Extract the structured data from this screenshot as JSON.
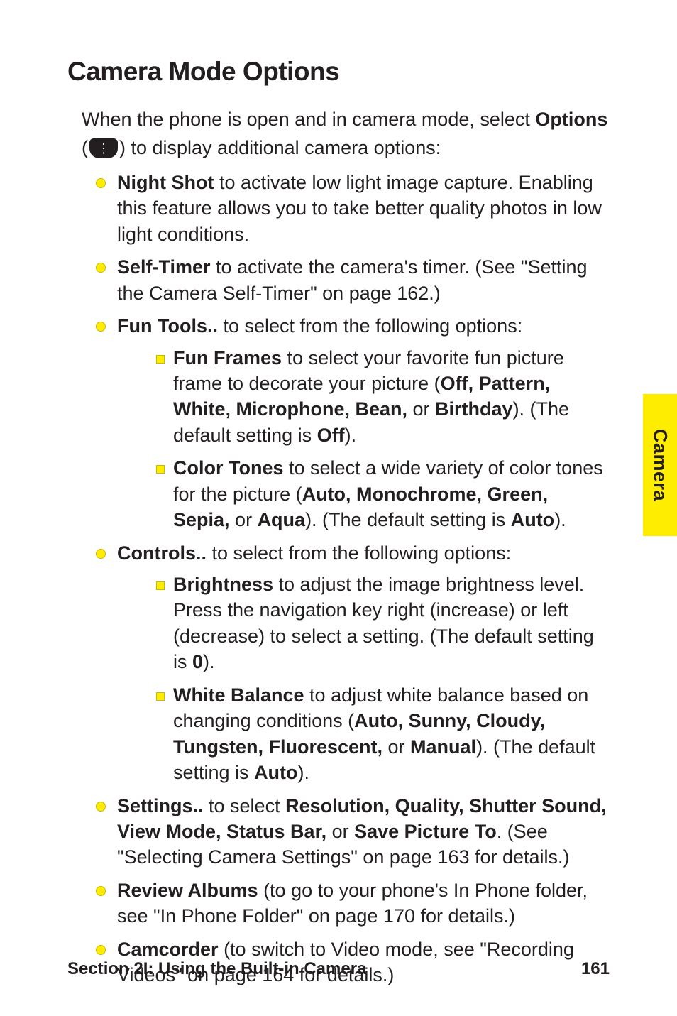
{
  "heading": "Camera Mode Options",
  "intro_line1_a": "When the phone is open and in camera mode, select ",
  "intro_line1_b": "Options",
  "intro_line2_a": "(",
  "intro_line2_b": ") to display additional camera options:",
  "bullets": {
    "night_shot_b": "Night Shot",
    "night_shot_t": " to activate low light image capture. Enabling this feature allows you to take better quality photos in low light conditions.",
    "self_timer_b": "Self-Timer",
    "self_timer_t": " to activate the camera's timer. (See \"Setting the Camera Self-Timer\" on page 162.)",
    "fun_tools_b": "Fun Tools..",
    "fun_tools_t": " to select from the following options:",
    "fun_frames_b": "Fun Frames",
    "fun_frames_t1": " to select your favorite fun picture frame to decorate your picture (",
    "fun_frames_opts": "Off, Pattern, White, Microphone, Bean, ",
    "fun_frames_or": "or ",
    "fun_frames_last": "Birthday",
    "fun_frames_t2": "). (The default setting is ",
    "fun_frames_def": "Off",
    "fun_frames_t3": ").",
    "color_tones_b": "Color Tones",
    "color_tones_t1": " to select a wide variety of color tones for the picture (",
    "color_tones_opts": "Auto, Monochrome, Green, Sepia, ",
    "color_tones_or": "or ",
    "color_tones_last": "Aqua",
    "color_tones_t2": "). (The default setting is ",
    "color_tones_def": "Auto",
    "color_tones_t3": ").",
    "controls_b": "Controls..",
    "controls_t": " to select from the following options:",
    "brightness_b": "Brightness",
    "brightness_t1": " to adjust the image brightness level. Press the navigation key right (increase) or left (decrease) to select a setting. (The default setting is ",
    "brightness_def": "0",
    "brightness_t2": ").",
    "wb_b": "White Balance",
    "wb_t1": " to adjust white balance based on changing conditions (",
    "wb_opts": "Auto, Sunny, Cloudy, Tungsten, Fluorescent, ",
    "wb_or": "or ",
    "wb_last": "Manual",
    "wb_t2": "). (The default setting is ",
    "wb_def": "Auto",
    "wb_t3": ").",
    "settings_b": "Settings..",
    "settings_t1": " to select ",
    "settings_opts": "Resolution, Quality, Shutter Sound, View Mode, Status Bar, ",
    "settings_or": "or ",
    "settings_last": "Save Picture To",
    "settings_t2": ". (See \"Selecting Camera Settings\" on page 163 for details.)",
    "review_b": "Review Albums",
    "review_t": " (to go to your phone's In Phone folder, see \"In Phone Folder\" on page 170 for details.)",
    "camcorder_b": "Camcorder",
    "camcorder_t": " (to switch to Video mode, see \"Recording Videos\" on page 164 for details.)"
  },
  "side_tab": "Camera",
  "footer_left": "Section 2I: Using the Built-in Camera",
  "footer_right": "161"
}
